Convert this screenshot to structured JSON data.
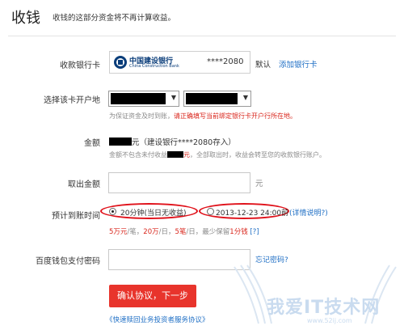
{
  "header": {
    "title": "收钱",
    "subtitle": "收钱的这部分资金将不再计算收益。"
  },
  "bank_card": {
    "label": "收款银行卡",
    "bank_name": "中国建设银行",
    "bank_name_en": "China Construction Bank",
    "card_number": "****2080",
    "default_text": "默认",
    "add_card_link": "添加银行卡"
  },
  "branch": {
    "label": "选择该卡开户地",
    "hint_prefix": "为保证资金及时到账，",
    "hint_red": "请正确填写当前绑定银行卡开户行所在地。"
  },
  "amount": {
    "label": "金额",
    "unit": "元",
    "deposit_text": "（建设银行****2080存入）",
    "note_prefix": "金额不包含未付收益",
    "note_red": "元",
    "note_suffix": "，全部取出时，收益会转至您的收款银行账户。"
  },
  "withdraw": {
    "label": "取出金额",
    "unit": "元"
  },
  "arrival": {
    "label": "预计到账时间",
    "option1": "20分钟(当日无收益)",
    "option2": "2013-12-23 24:00前",
    "details_link": "(详情说明?)",
    "limit_1_red": "5万元",
    "limit_1_sep": "/笔，",
    "limit_2_red": "20万",
    "limit_2_sep": "/日，",
    "limit_3_red": "5笔",
    "limit_3_sep": "/日，最少保留",
    "limit_4_red": "1分钱",
    "help_link": "[?]"
  },
  "password": {
    "label": "百度钱包支付密码",
    "forgot_link": "忘记密码?"
  },
  "actions": {
    "confirm_button": "确认协议，下一步",
    "agreement_link": "《快速赎回业务投资者服务协议》"
  },
  "watermark": {
    "text": "我爱IT技术网",
    "url": "www.52ij.com"
  }
}
